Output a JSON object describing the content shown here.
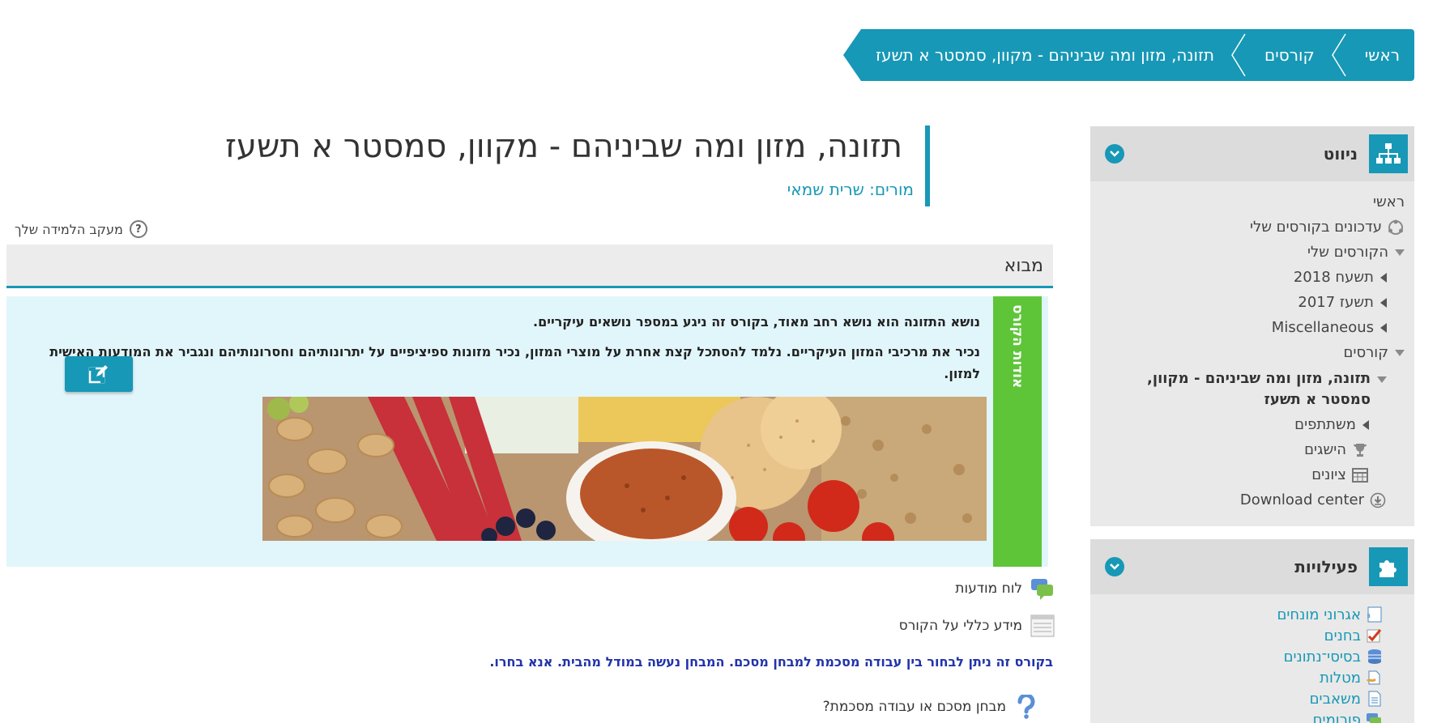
{
  "breadcrumb": {
    "items": [
      "ראשי",
      "קורסים",
      "תזונה, מזון ומה שביניהם - מקוון, סמסטר א תשעז"
    ]
  },
  "navigation_block": {
    "title": "ניווט",
    "home": "ראשי",
    "my_course_updates": "עדכונים בקורסים שלי",
    "my_courses": "הקורסים שלי",
    "year_2018": "תשעח 2018",
    "year_2017": "תשעז 2017",
    "misc": "Miscellaneous",
    "courses": "קורסים",
    "current_course_line1": "תזונה, מזון ומה שביניהם - מקוון,",
    "current_course_line2": "סמסטר א תשעז",
    "participants": "משתתפים",
    "badges": "הישגים",
    "grades": "ציונים",
    "download_center": "Download center"
  },
  "activities_block": {
    "title": "פעילויות",
    "items": [
      "אגרוני מונחים",
      "בחנים",
      "בסיסי־נתונים",
      "מטלות",
      "משאבים",
      "פורומים"
    ]
  },
  "course": {
    "title": "תזונה, מזון ומה שביניהם - מקוון, סמסטר א תשעז",
    "teachers": "מורים: שרית שמאי",
    "progress_label": "מעקב הלמידה שלך",
    "progress_help": "?"
  },
  "section": {
    "name": "מבוא",
    "about_tab": "אודות הקורס",
    "paragraph1": "נושא התזונה הוא נושא רחב מאוד, בקורס זה ניגע במספר נושאים עיקריים.",
    "paragraph2": "נכיר את מרכיבי המזון העיקריים. נלמד להסתכל קצת אחרת על מוצרי המזון, נכיר מזונות ספיציפיים על יתרונותיהם וחסרונותיהם ונגביר את המודעות האישית למזון."
  },
  "activities": {
    "forum": "לוח מודעות",
    "info": "מידע כללי על הקורס",
    "notice": "בקורס זה ניתן לבחור בין עבודה מסכמת למבחן מסכם. המבחן נעשה במודל מהבית. אנא בחרו.",
    "choice": "מבחן מסכם או עבודה מסכמת?"
  },
  "colors": {
    "accent": "#1798b6",
    "about_tab": "#5ec539",
    "about_bg": "#e1f6fb",
    "notice": "#2233aa"
  }
}
